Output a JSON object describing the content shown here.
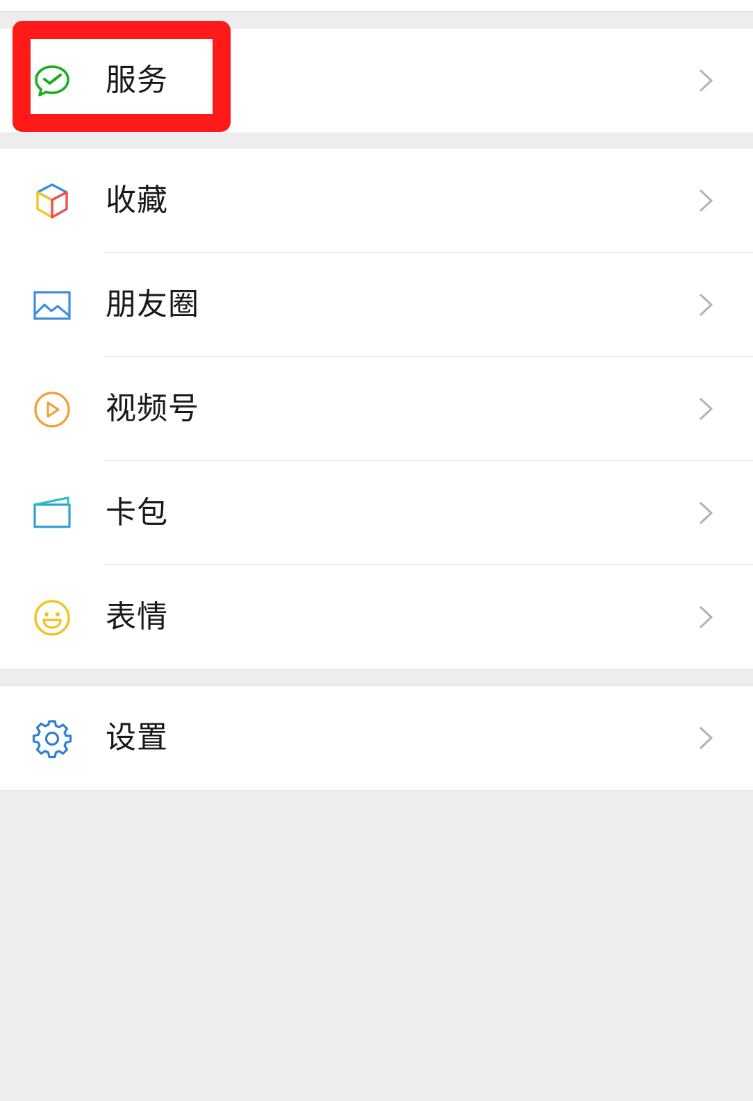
{
  "menu": {
    "service": {
      "label": "服务",
      "icon": "wechat-pay-icon",
      "color": "#1aad19"
    },
    "group2": [
      {
        "key": "favorites",
        "label": "收藏",
        "icon": "cube-icon"
      },
      {
        "key": "moments",
        "label": "朋友圈",
        "icon": "image-icon"
      },
      {
        "key": "channels",
        "label": "视频号",
        "icon": "play-circle-icon"
      },
      {
        "key": "cards",
        "label": "卡包",
        "icon": "card-wallet-icon"
      },
      {
        "key": "stickers",
        "label": "表情",
        "icon": "smiley-icon"
      }
    ],
    "settings": {
      "label": "设置",
      "icon": "gear-icon",
      "color": "#2e7fd1"
    }
  },
  "annotation": {
    "highlight_color": "#ff1a1a"
  }
}
